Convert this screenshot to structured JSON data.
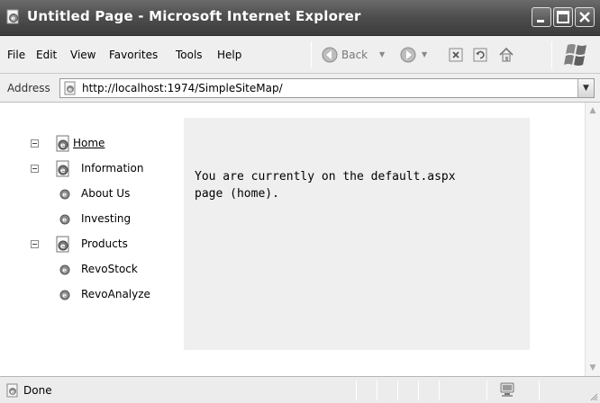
{
  "window": {
    "title": "Untitled Page - Microsoft Internet Explorer",
    "buttons": {
      "minimize": "minimize",
      "maximize": "maximize",
      "close": "close"
    }
  },
  "menu": {
    "items": [
      {
        "label": "File"
      },
      {
        "label": "Edit"
      },
      {
        "label": "View"
      },
      {
        "label": "Favorites"
      },
      {
        "label": "Tools"
      },
      {
        "label": "Help"
      }
    ]
  },
  "toolbar": {
    "back_label": "Back",
    "icons": [
      "back-icon",
      "forward-icon",
      "stop-icon",
      "refresh-icon",
      "home-icon"
    ]
  },
  "address": {
    "label": "Address",
    "url": "http://localhost:1974/SimpleSiteMap/"
  },
  "tree": {
    "nodes": [
      {
        "label": "Home",
        "type": "parent",
        "link": true
      },
      {
        "label": "Information",
        "type": "parent",
        "link": false
      },
      {
        "label": "About Us",
        "type": "leaf",
        "link": false
      },
      {
        "label": "Investing",
        "type": "leaf",
        "link": false
      },
      {
        "label": "Products",
        "type": "parent",
        "link": false
      },
      {
        "label": "RevoStock",
        "type": "leaf",
        "link": false
      },
      {
        "label": "RevoAnalyze",
        "type": "leaf",
        "link": false
      }
    ]
  },
  "content": {
    "line1": "You are currently on the default.aspx",
    "line2": "page (home)."
  },
  "status": {
    "text": "Done"
  },
  "colors": {
    "titlebar": "#4f4f4f",
    "panel": "#efefef",
    "chrome": "#efefef"
  }
}
